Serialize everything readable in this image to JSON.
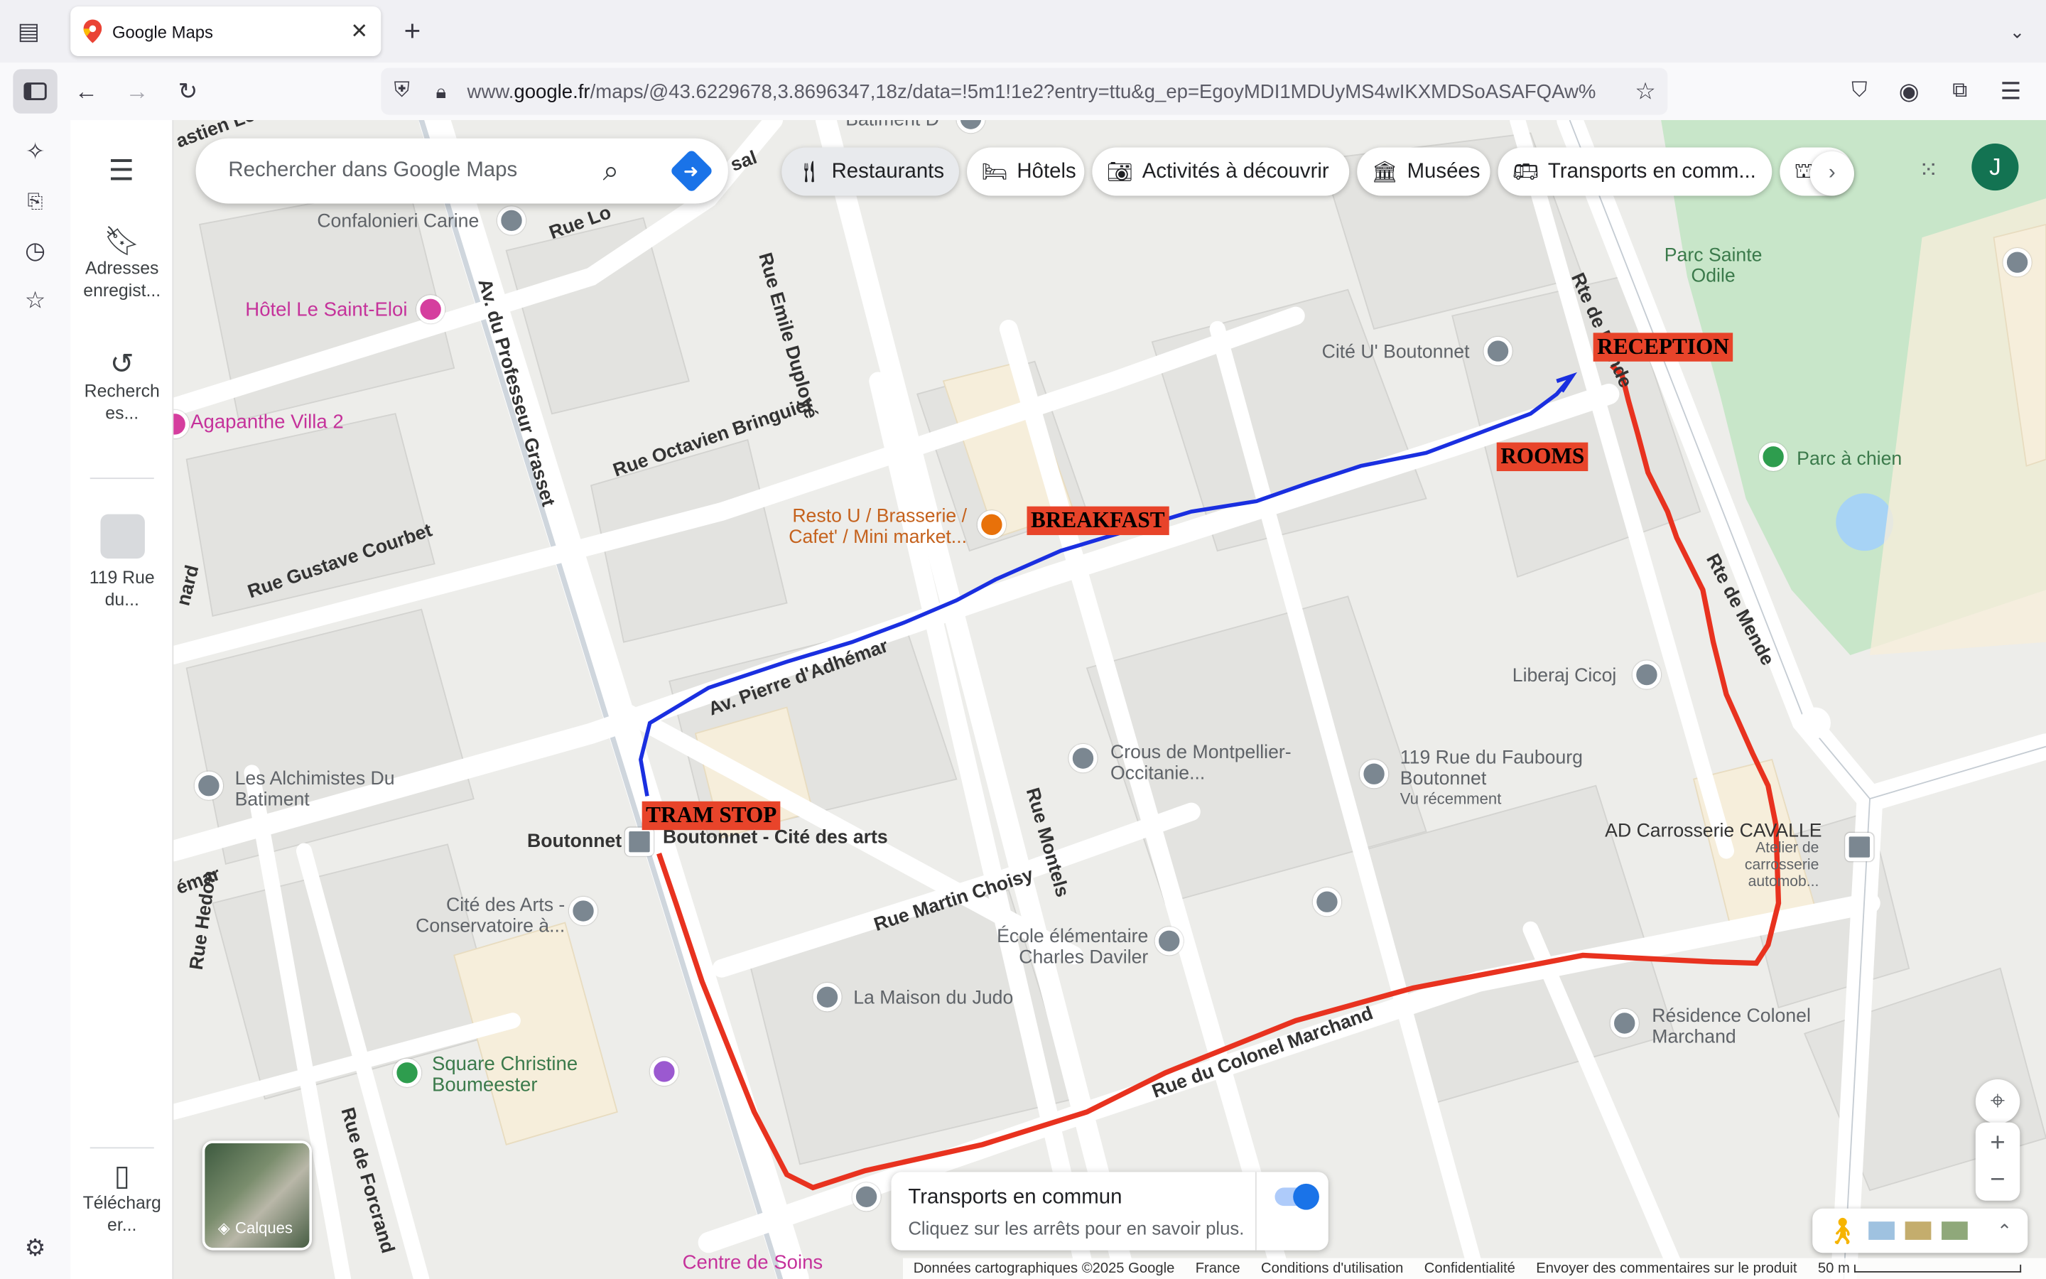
{
  "browser": {
    "tab_title": "Google Maps",
    "tab_close": "✕",
    "new_tab": "+",
    "url_prefix": "www.",
    "url_domain": "google.fr",
    "url_rest": "/maps/@43.6229678,3.8696347,18z/data=!5m1!1e2?entry=ttu&g_ep=EgoyMDI1MDUyMS4wIKXMDSoASAFQAw%"
  },
  "rail": {
    "saved": "Adresses enregist...",
    "recent": "Recherch es...",
    "recent_place": "119 Rue du...",
    "download": "Télécharg er..."
  },
  "search": {
    "placeholder": "Rechercher dans Google Maps"
  },
  "chips": [
    {
      "label": "Restaurants",
      "icon": "fork-knife-icon"
    },
    {
      "label": "Hôtels",
      "icon": "bed-icon"
    },
    {
      "label": "Activités à découvrir",
      "icon": "camera-icon"
    },
    {
      "label": "Musées",
      "icon": "museum-icon"
    },
    {
      "label": "Transports en comm...",
      "icon": "bus-icon"
    }
  ],
  "account_initial": "J",
  "map": {
    "streets": {
      "rue_emile_duploye": "Rue Emile Duployé",
      "av_professeur_grasset": "Av. du Professeur Grasset",
      "rue_octavien_bringuier": "Rue Octavien Bringuier",
      "rue_gustave_courbet": "Rue Gustave Courbet",
      "av_pierre_adhemar": "Av. Pierre d'Adhémar",
      "rue_martin_choisy": "Rue Martin Choisy",
      "rue_montels": "Rue Montels",
      "rue_colonel_marchand": "Rue du Colonel Marchand",
      "rte_de_mende_1": "Rte de Mende",
      "rte_de_mende_2": "Rte de Mende",
      "rue_de_forcrand": "Rue de Forcrand",
      "rue_hedon": "Rue Hedon",
      "rue_lou": "Rue Lo",
      "bastien": "astien Lo",
      "nard": "nard",
      "ema": "émar",
      "ssal": "sal"
    },
    "places": {
      "confalonieri": "Confalonieri Carine",
      "hotel_saint_eloi": "Hôtel Le Saint-Eloi",
      "agapanthe": "Agapanthe Villa 2",
      "resto_u": "Resto U / Brasserie / Cafet' / Mini market...",
      "cite_u": "Cité U' Boutonnet",
      "parc_sainte_odile": "Parc Sainte Odile",
      "parc_chien": "Parc à chien",
      "liberaj": "Liberaj Cicoj",
      "crous": "Crous de Montpellier-Occitanie...",
      "rue_faubourg": "119 Rue du Faubourg Boutonnet",
      "vu_recemment": "Vu récemment",
      "alchimistes": "Les Alchimistes Du Batiment",
      "boutonnet": "Boutonnet",
      "boutonnet_cite": "Boutonnet - Cité des arts",
      "cite_arts": "Cité des Arts - Conservatoire à...",
      "ecole": "École élémentaire Charles Daviler",
      "maison_judo": "La Maison du Judo",
      "square_christine": "Square Christine Boumeester",
      "residence": "Résidence Colonel Marchand",
      "carrosserie": "AD Carrosserie CAVALLE",
      "atelier": "Atelier de carrosserie automob...",
      "centre_soins": "Centre de Soins",
      "batiment_d": "Batiment D"
    },
    "annotations": {
      "reception": "RECEPTION",
      "rooms": "ROOMS",
      "breakfast": "BREAKFAST",
      "tram_stop": "TRAM STOP"
    },
    "route_colors": {
      "blue": "#1a2fe0",
      "red": "#e8321f"
    }
  },
  "transit_panel": {
    "title": "Transports en commun",
    "subtitle": "Cliquez sur les arrêts pour en savoir plus.",
    "toggle_on": true
  },
  "layers_label": "Calques",
  "footer": {
    "data": "Données cartographiques ©2025 Google",
    "country": "France",
    "terms": "Conditions d'utilisation",
    "privacy": "Confidentialité",
    "feedback": "Envoyer des commentaires sur le produit",
    "scale": "50 m"
  },
  "colors": {
    "accent": "#1a73e8",
    "annotation_bg": "#e8442a"
  }
}
